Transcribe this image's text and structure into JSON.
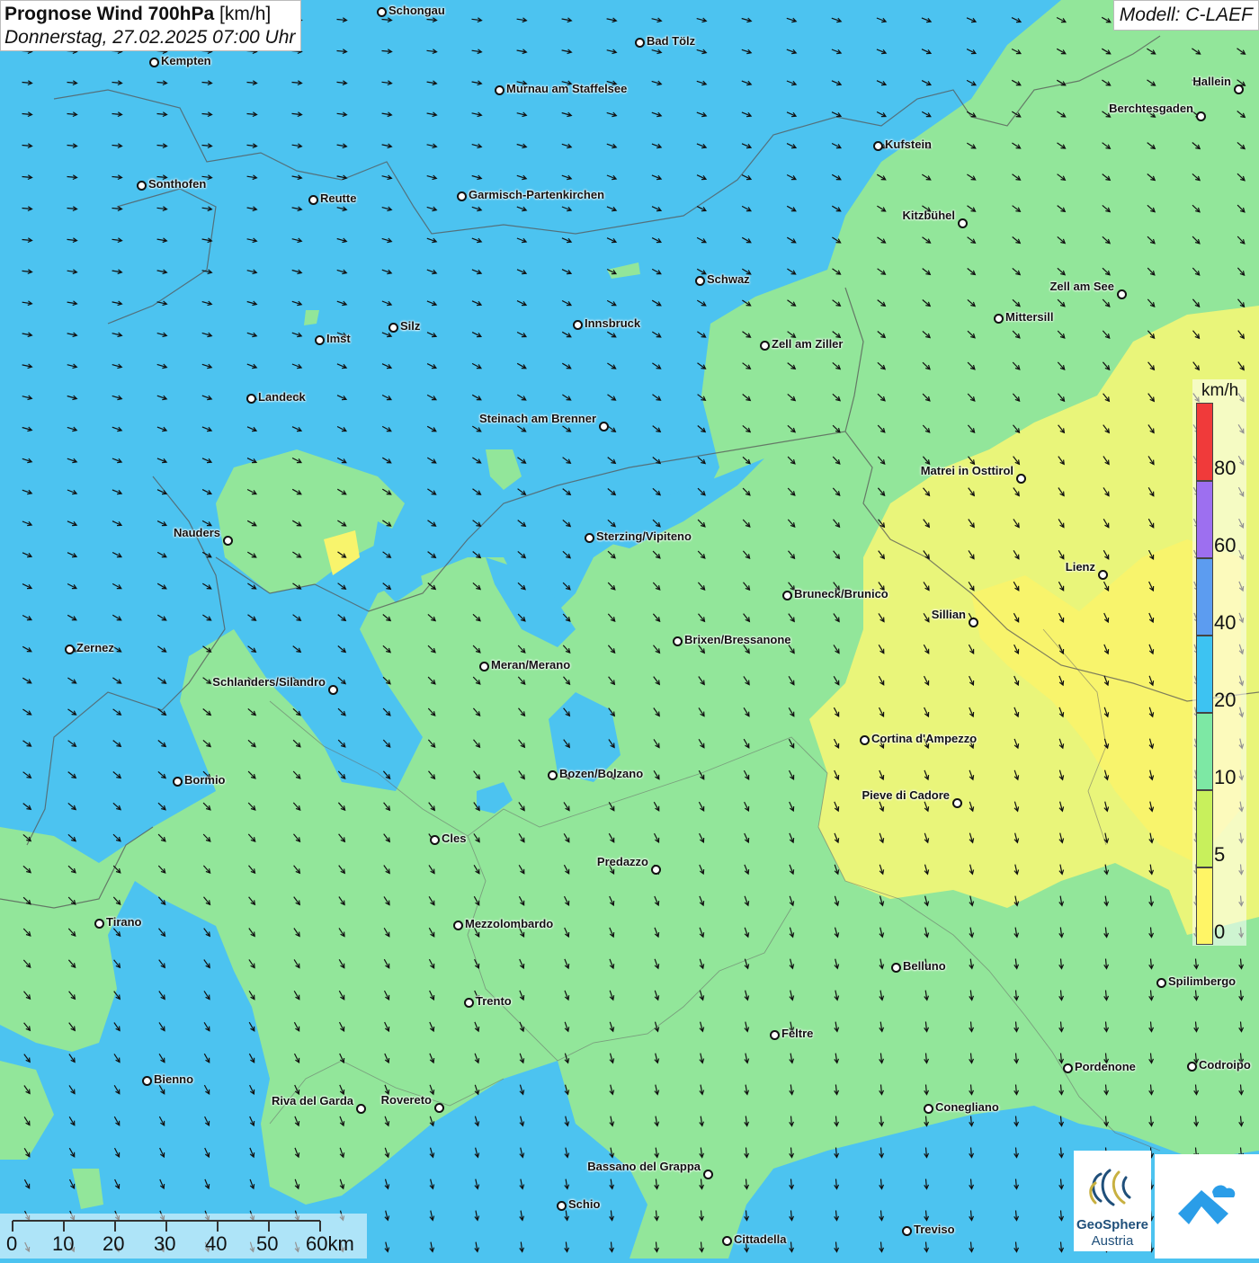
{
  "header": {
    "title": "Prognose Wind 700hPa",
    "unit": "[km/h]",
    "datetime": "Donnerstag, 27.02.2025 07:00 Uhr",
    "model": "Modell: C-LAEF"
  },
  "legend": {
    "unit": "km/h",
    "labels": [
      "80",
      "60",
      "40",
      "20",
      "10",
      "5",
      "0"
    ],
    "colors": [
      "#f03a3a",
      "#9d6ff0",
      "#5c9cf0",
      "#3dc3f2",
      "#7de8a4",
      "#c8f05c",
      "#fff566"
    ]
  },
  "scale_bar": {
    "labels": [
      "0",
      "10",
      "20",
      "30",
      "40",
      "50",
      "60km"
    ]
  },
  "logos": {
    "geosphere_line1": "GeoSphere",
    "geosphere_line2": "Austria"
  },
  "cities": [
    {
      "name": "Schongau"
    },
    {
      "name": "Bad Tölz"
    },
    {
      "name": "Kempten"
    },
    {
      "name": "Murnau am Staffelsee"
    },
    {
      "name": "Hallein"
    },
    {
      "name": "Berchtesgaden"
    },
    {
      "name": "Kufstein"
    },
    {
      "name": "Sonthofen"
    },
    {
      "name": "Reutte"
    },
    {
      "name": "Garmisch-Partenkirchen"
    },
    {
      "name": "Kitzbühel"
    },
    {
      "name": "Schwaz"
    },
    {
      "name": "Zell am See"
    },
    {
      "name": "Mittersill"
    },
    {
      "name": "Silz"
    },
    {
      "name": "Innsbruck"
    },
    {
      "name": "Imst"
    },
    {
      "name": "Zell am Ziller"
    },
    {
      "name": "Landeck"
    },
    {
      "name": "Steinach am Brenner"
    },
    {
      "name": "Matrei in Osttirol"
    },
    {
      "name": "Nauders"
    },
    {
      "name": "Sterzing/Vipiteno"
    },
    {
      "name": "Lienz"
    },
    {
      "name": "Bruneck/Brunico"
    },
    {
      "name": "Sillian"
    },
    {
      "name": "Brixen/Bressanone"
    },
    {
      "name": "Zernez"
    },
    {
      "name": "Meran/Merano"
    },
    {
      "name": "Schlanders/Silandro"
    },
    {
      "name": "Cortina d'Ampezzo"
    },
    {
      "name": "Bozen/Bolzano"
    },
    {
      "name": "Bormio"
    },
    {
      "name": "Pieve di Cadore"
    },
    {
      "name": "Cles"
    },
    {
      "name": "Predazzo"
    },
    {
      "name": "Tirano"
    },
    {
      "name": "Mezzolombardo"
    },
    {
      "name": "Belluno"
    },
    {
      "name": "Spilimbergo"
    },
    {
      "name": "Trento"
    },
    {
      "name": "Feltre"
    },
    {
      "name": "Pordenone"
    },
    {
      "name": "Codroipo"
    },
    {
      "name": "Bienno"
    },
    {
      "name": "Riva del Garda"
    },
    {
      "name": "Rovereto"
    },
    {
      "name": "Conegliano"
    },
    {
      "name": "Bassano del Grappa"
    },
    {
      "name": "Schio"
    },
    {
      "name": "Treviso"
    },
    {
      "name": "Cittadella"
    }
  ]
}
